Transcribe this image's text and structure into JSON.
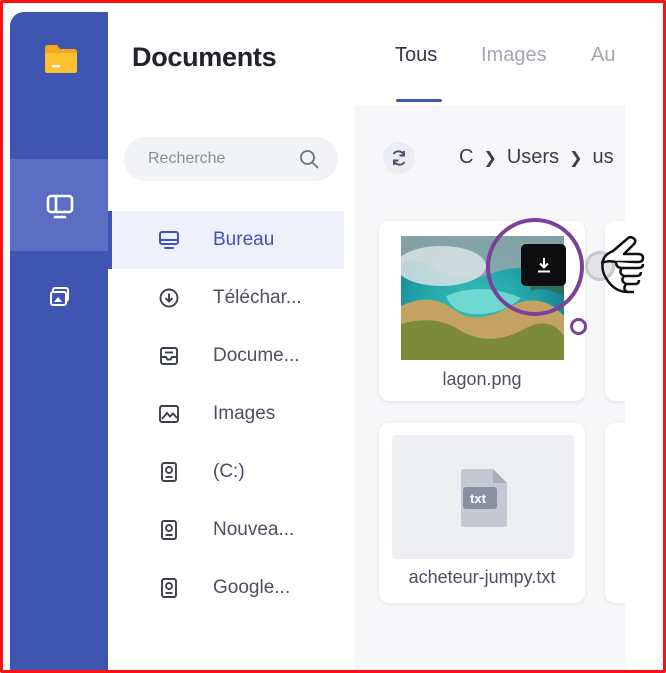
{
  "app": {
    "title": "Documents"
  },
  "search": {
    "placeholder": "Recherche"
  },
  "sidebar": {
    "items": [
      {
        "label": "Bureau",
        "icon": "monitor-icon",
        "active": true
      },
      {
        "label": "Téléchar...",
        "icon": "download-circle-icon"
      },
      {
        "label": "Docume...",
        "icon": "document-tray-icon"
      },
      {
        "label": "Images",
        "icon": "image-icon"
      },
      {
        "label": "(C:)",
        "icon": "drive-icon"
      },
      {
        "label": "Nouvea...",
        "icon": "drive-icon"
      },
      {
        "label": "Google...",
        "icon": "drive-icon"
      }
    ]
  },
  "tabs": [
    {
      "label": "Tous",
      "active": true
    },
    {
      "label": "Images"
    },
    {
      "label": "Au"
    }
  ],
  "breadcrumb": [
    "C",
    "Users",
    "us"
  ],
  "files": [
    {
      "name": "lagon.png",
      "type": "image"
    },
    {
      "name": "acheteur-jumpy.txt",
      "type": "text",
      "badge": "txt"
    }
  ],
  "colors": {
    "accent": "#3f55b2",
    "rail": "#3f55b2",
    "highlight_ring": "#7b3f9c",
    "frame": "#ff1010"
  }
}
